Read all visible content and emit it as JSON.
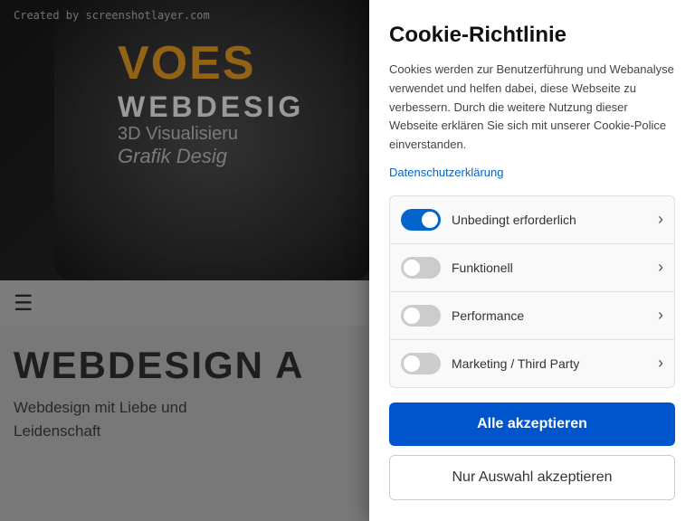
{
  "watermark": "Created by screenshotlayer.com",
  "background": {
    "logo_voes": "VOES",
    "logo_webdesign": "WEBDESIG",
    "logo_3d": "3D Visualisieru",
    "logo_grafik": "Grafik Desig",
    "nav_icon": "☰",
    "content_title": "WEBDESIGN A",
    "content_subtitle_line1": "Webdesign mit Liebe und",
    "content_subtitle_line2": "Leidenschaft"
  },
  "cookie_modal": {
    "title": "Cookie-Richtlinie",
    "description": "Cookies werden zur Benutzerführung und Webanalyse verwendet und helfen dabei, diese Webseite zu verbessern. Durch die weitere Nutzung dieser Webseite erklären Sie sich mit unserer Cookie-Police einverstanden.",
    "privacy_link": "Datenschutzerklärung",
    "options": [
      {
        "id": "unbedingt",
        "label": "Unbedingt erforderlich",
        "active": true
      },
      {
        "id": "funktionell",
        "label": "Funktionell",
        "active": false
      },
      {
        "id": "performance",
        "label": "Performance",
        "active": false
      },
      {
        "id": "marketing",
        "label": "Marketing / Third Party",
        "active": false
      }
    ],
    "btn_all_accept": "Alle akzeptieren",
    "btn_selection_accept": "Nur Auswahl akzeptieren"
  }
}
